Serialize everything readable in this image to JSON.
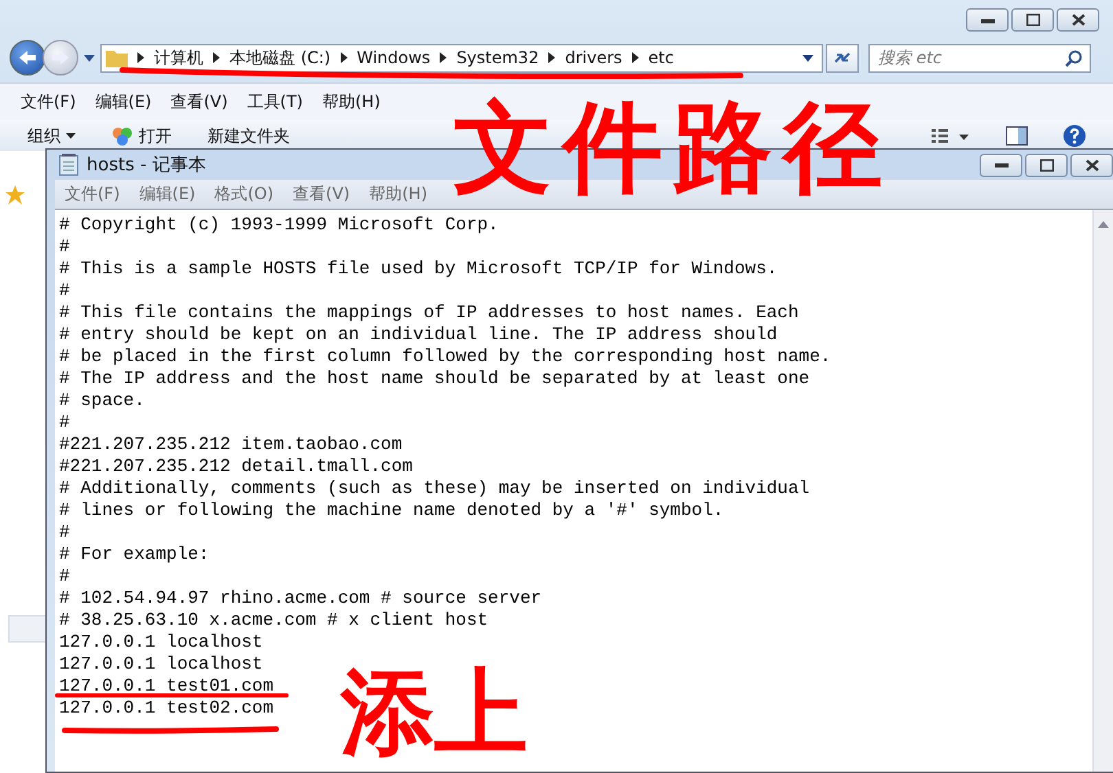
{
  "explorer": {
    "address_path": [
      "计算机",
      "本地磁盘 (C:)",
      "Windows",
      "System32",
      "drivers",
      "etc"
    ],
    "search": {
      "placeholder": "搜索 etc"
    },
    "menu": [
      "文件(F)",
      "编辑(E)",
      "查看(V)",
      "工具(T)",
      "帮助(H)"
    ],
    "toolbar": [
      {
        "label": "组织",
        "kind": "dropdown"
      },
      {
        "label": "打开",
        "kind": "open"
      },
      {
        "label": "新建文件夹",
        "kind": "plain"
      }
    ]
  },
  "notepad": {
    "title": "hosts - 记事本",
    "menu": [
      "文件(F)",
      "编辑(E)",
      "格式(O)",
      "查看(V)",
      "帮助(H)"
    ],
    "lines": [
      "# Copyright (c) 1993-1999 Microsoft Corp.",
      "#",
      "# This is a sample HOSTS file used by Microsoft TCP/IP for Windows.",
      "#",
      "# This file contains the mappings of IP addresses to host names. Each",
      "# entry should be kept on an individual line. The IP address should",
      "# be placed in the first column followed by the corresponding host name.",
      "# The IP address and the host name should be separated by at least one",
      "# space.",
      "#",
      "#221.207.235.212 item.taobao.com",
      "#221.207.235.212 detail.tmall.com",
      "# Additionally, comments (such as these) may be inserted on individual",
      "# lines or following the machine name denoted by a '#' symbol.",
      "#",
      "# For example:",
      "#",
      "# 102.54.94.97 rhino.acme.com # source server",
      "# 38.25.63.10 x.acme.com # x client host",
      "127.0.0.1 localhost",
      "127.0.0.1 localhost",
      "127.0.0.1 test01.com",
      "127.0.0.1 test02.com"
    ]
  },
  "annotations": [
    {
      "text": "文件路径",
      "kind": "path"
    },
    {
      "text": "添上",
      "kind": "add"
    }
  ]
}
